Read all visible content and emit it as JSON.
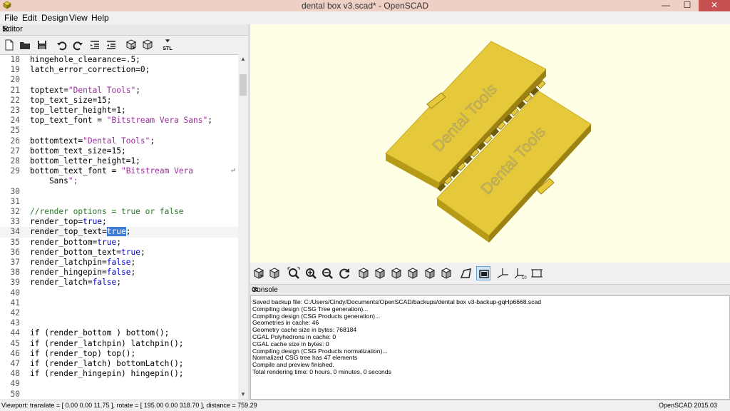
{
  "window": {
    "title": "dental box v3.scad* - OpenSCAD",
    "min_glyph": "—",
    "max_glyph": "☐",
    "close_glyph": "✕"
  },
  "menu": [
    "File",
    "Edit",
    "Design",
    "View",
    "Help"
  ],
  "editor": {
    "title": "Editor",
    "close_glyph": "✕",
    "toolbar_icons": [
      "new-file-icon",
      "open-file-icon",
      "save-icon",
      "undo-icon",
      "redo-icon",
      "unindent-icon",
      "indent-icon",
      "preview-icon",
      "render-icon",
      "export-stl-icon"
    ],
    "stl_label": "STL",
    "lines": [
      {
        "n": "18",
        "t": "hingehole_clearance=.5;"
      },
      {
        "n": "19",
        "t": "latch_error_correction=0;"
      },
      {
        "n": "20",
        "t": ""
      },
      {
        "n": "21",
        "t": "toptext=\"Dental Tools\";"
      },
      {
        "n": "22",
        "t": "top_text_size=15;"
      },
      {
        "n": "23",
        "t": "top_letter_height=1;"
      },
      {
        "n": "24",
        "t": "top_text_font = \"Bitstream Vera Sans\";"
      },
      {
        "n": "25",
        "t": ""
      },
      {
        "n": "26",
        "t": "bottomtext=\"Dental Tools\";"
      },
      {
        "n": "27",
        "t": "bottom_text_size=15;"
      },
      {
        "n": "28",
        "t": "bottom_letter_height=1;"
      },
      {
        "n": "29",
        "t": "bottom_text_font = \"Bitstream Vera"
      },
      {
        "n": "",
        "t": "    Sans\";"
      },
      {
        "n": "30",
        "t": ""
      },
      {
        "n": "31",
        "t": ""
      },
      {
        "n": "32",
        "t": "//render options = true or false"
      },
      {
        "n": "33",
        "t": "render_top=true;"
      },
      {
        "n": "34",
        "t": "render_top_text=true;"
      },
      {
        "n": "35",
        "t": "render_bottom=true;"
      },
      {
        "n": "36",
        "t": "render_bottom_text=true;"
      },
      {
        "n": "37",
        "t": "render_latchpin=false;"
      },
      {
        "n": "38",
        "t": "render_hingepin=false;"
      },
      {
        "n": "39",
        "t": "render_latch=false;"
      },
      {
        "n": "40",
        "t": ""
      },
      {
        "n": "41",
        "t": ""
      },
      {
        "n": "42",
        "t": ""
      },
      {
        "n": "43",
        "t": ""
      },
      {
        "n": "44",
        "t": "if (render_bottom ) bottom();"
      },
      {
        "n": "45",
        "t": "if (render_latchpin) latchpin();"
      },
      {
        "n": "46",
        "t": "if (render_top) top();"
      },
      {
        "n": "47",
        "t": "if (render_latch) bottomLatch();"
      },
      {
        "n": "48",
        "t": "if (render_hingepin) hingepin();"
      },
      {
        "n": "49",
        "t": ""
      },
      {
        "n": "50",
        "t": ""
      }
    ],
    "current_line": "34",
    "selected_word": "true",
    "wrap_marker": "⏎"
  },
  "viewport": {
    "top_text": "Dental Tools",
    "bottom_text": "Dental Tools",
    "colors": {
      "background": "#ffffe5",
      "model_face": "#e6c93a",
      "model_side": "#b79a16",
      "text": "#c8b86a"
    }
  },
  "view_toolbar_icons": [
    "preview-icon",
    "render-icon",
    "zoom-all-icon",
    "zoom-in-icon",
    "zoom-out-icon",
    "reset-view-icon",
    "view-right-icon",
    "view-top-icon",
    "view-bottom-icon",
    "view-left-icon",
    "view-front-icon",
    "view-back-icon",
    "perspective-icon",
    "orthogonal-icon",
    "show-axes-icon",
    "show-scale-markers-icon",
    "show-edges-icon"
  ],
  "console": {
    "title": "Console",
    "close_glyph": "✕",
    "lines": [
      "Saved backup file: C:/Users/Cindy/Documents/OpenSCAD/backups/dental box v3-backup-gqHp6668.scad",
      "Compiling design (CSG Tree generation)...",
      "Compiling design (CSG Products generation)...",
      "Geometries in cache: 46",
      "Geometry cache size in bytes: 768184",
      "CGAL Polyhedrons in cache: 0",
      "CGAL cache size in bytes: 0",
      "Compiling design (CSG Products normalization)...",
      "Normalized CSG tree has 47 elements",
      "Compile and preview finished.",
      "Total rendering time: 0 hours, 0 minutes, 0 seconds"
    ]
  },
  "status": {
    "viewport": "Viewport: translate = [ 0.00 0.00 11.75 ], rotate = [ 195.00 0.00 318.70 ], distance = 759.29",
    "version": "OpenSCAD 2015.03"
  }
}
